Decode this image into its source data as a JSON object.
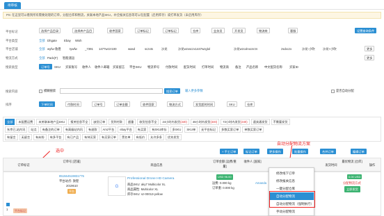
{
  "tab": "待审核",
  "notice": {
    "text": "PS: 在这里可以看到所有需要处理的订单，分配仓库和物流，关联本地产品SKU，补全报关信息等可以在配置（启用库存）或打单发货（未启用库存）"
  },
  "filters": {
    "platform_label": "平台标记",
    "platform_buttons": [
      "选择产品目录",
      "选择库产品目",
      "仓库",
      "收件国家",
      "订单标记",
      "订单标记",
      "仓库",
      "业务员",
      "开发员",
      "物流商",
      "客服",
      "设置查询条件"
    ],
    "platform_label2": "平台类型",
    "platforms": [
      "全部",
      "Dhgate",
      "Ebay",
      "Wish"
    ],
    "store_label": "平台店铺",
    "stores": [
      "全部",
      "wyfw-敦煌",
      "tywfw",
      "_7391",
      "1477wzzr100",
      "wasd",
      "sczxts",
      "沙龙",
      "沙龙wzxsczx1447wzglol",
      "沙龙wzcolnxcnrzn",
      "zsdxczx",
      "沙龙-小吹",
      "沙龙+小吹"
    ],
    "more": "更多",
    "logistics_label": "物流方式",
    "logistics": [
      "全部",
      "Pack(F)",
      "智能速运"
    ],
    "search_type_label": "搜索类型",
    "search_types": [
      "订单号",
      "SKU",
      "买家账号",
      "收件人",
      "收件人邮箱",
      "买家留言",
      "平台SKU",
      "物流单号",
      "付款时间",
      "配货时间",
      "打单时间",
      "物流商",
      "备注",
      "产品名称",
      "中文配货名称",
      "买家ID"
    ],
    "search_content_label": "搜索内容",
    "fuzzy": "模糊搜索",
    "search_btn": "搜索订单",
    "more_conditions": "输入更多参数",
    "auto_alloc": "是否自动分配",
    "sort_label": "排序",
    "sort_btns": [
      "下单时间",
      "付款时间",
      "订单号",
      "订单金额",
      "收件国家",
      "物流方式",
      "发货超时时间",
      "SKU",
      "仓库"
    ]
  },
  "status": {
    "row1": [
      {
        "t": "全部",
        "sel": true
      },
      {
        "t": "未配置运费"
      },
      {
        "t": "未关联本地产品SKU"
      },
      {
        "t": "报关信息不全"
      },
      {
        "t": "缺货订单"
      },
      {
        "t": "货到付款"
      },
      {
        "t": "超重"
      },
      {
        "t": "收货信息不全"
      },
      {
        "t": "24小时内发货",
        "n": "340"
      },
      {
        "t": "48小时内发货",
        "n": "340"
      },
      {
        "t": "72小时内发货",
        "n": "340"
      },
      {
        "t": "速卖通发货"
      },
      {
        "t": "不需要发货"
      }
    ],
    "row2": [
      {
        "t": "东京已,站内讯"
      },
      {
        "t": "站点"
      },
      {
        "t": "有备注的订单"
      },
      {
        "t": "有高级站内讯"
      },
      {
        "t": "有退款"
      },
      {
        "t": "Amz平台"
      },
      {
        "t": "ebay平台"
      },
      {
        "t": "有买家"
      },
      {
        "t": "有SKU库存"
      },
      {
        "t": "多SKU"
      },
      {
        "t": "SKU单"
      },
      {
        "t": "无平台标记"
      },
      {
        "t": "多数买家订单"
      },
      {
        "t": "单数买家订单"
      }
    ],
    "row3": [
      {
        "t": "有留言"
      },
      {
        "t": "无留言"
      },
      {
        "t": "有纠纷"
      },
      {
        "t": "有多平台"
      },
      {
        "t": "有已产品"
      },
      {
        "t": "有待买家"
      },
      {
        "t": "有买家订单"
      },
      {
        "t": "黑名单"
      },
      {
        "t": "有低价"
      },
      {
        "t": "允许多条"
      },
      {
        "t": "优先发货"
      }
    ]
  },
  "actions": {
    "audit": "+ 手工订单",
    "mark": "标记订单",
    "more": "更多操作",
    "batch": "批量操作",
    "merge": "合并订单",
    "combine": "编辑订单"
  },
  "annotation_top": "自动分配物流方案",
  "annotation_left": "选中",
  "table": {
    "headers": [
      "订单标记",
      "订单号 [店铺]",
      "商品信息",
      "订单金额 [运费/重量]",
      "收件人 [国家]",
      "物流方式 [仓库]",
      "发货时间",
      "最优物流 [仓库]",
      "操作"
    ]
  },
  "order": {
    "tag": "平台标记",
    "order_no": "851564519831775",
    "store_label": "平台站点: 敦煌",
    "store_date": "2019610",
    "badge": "平台",
    "product_title": "Professional Drone HD Camera",
    "sku_label": "商品SKU: aky7 Multicolor XL",
    "attr": "商品属性: Multicolor XL",
    "stock_label": "库存SKU: sz-00013-yellow",
    "amount": "USD 96.00",
    "ship": "运费: 0.000 kg",
    "weight": "订单重: 0.000 kg",
    "recipient": "Amanda",
    "ship_cost": "运费: 0.00",
    "best": "0.00 USD",
    "best_label": "分配物流方式",
    "best_btn": "立即发货"
  },
  "menu": {
    "items": [
      "修改线下订单",
      "修改报关信息",
      "一键分配仓库",
      "自动分配物流",
      "自动分配物流（强制执行）",
      "手动分配物流"
    ]
  },
  "colors": {
    "accent": "#2b8fd3",
    "alert": "#e22222",
    "green": "#3cb371"
  }
}
